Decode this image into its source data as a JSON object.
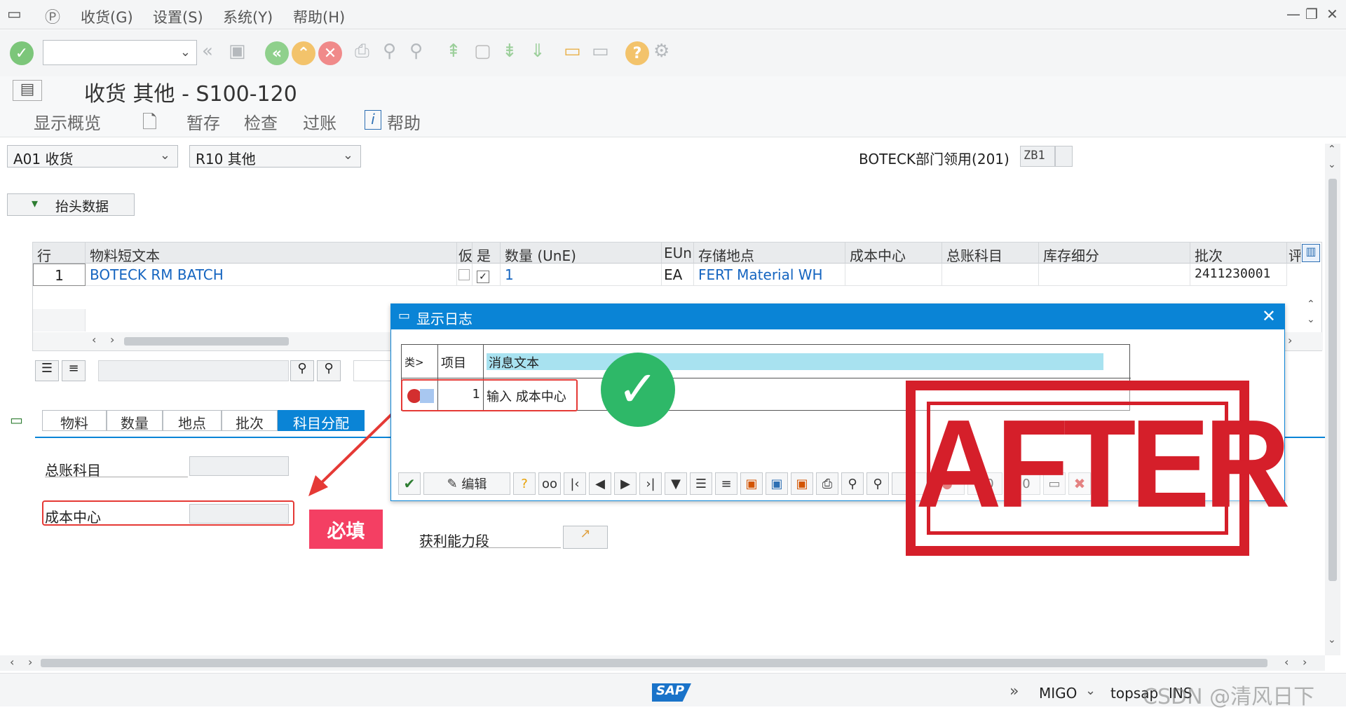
{
  "menu": {
    "items": [
      "收货(G)",
      "设置(S)",
      "系统(Y)",
      "帮助(H)"
    ]
  },
  "title": "收货 其他 - S100-120",
  "app_toolbar": {
    "overview": "显示概览",
    "hold": "暂存",
    "check": "检查",
    "post": "过账",
    "help": "帮助"
  },
  "selection": {
    "action": "A01 收货",
    "ref_doc": "R10 其他",
    "movement_text": "BOTECK部门领用(201)",
    "movement_code": "ZB1"
  },
  "header_data_button": "抬头数据",
  "table": {
    "headers": [
      "行",
      "物料短文本",
      "仮",
      "是",
      "数量 (UnE)",
      "EUn",
      "存储地点",
      "成本中心",
      "总账科目",
      "库存细分",
      "批次",
      "评"
    ],
    "row": {
      "line": "1",
      "material_text": "BOTECK RM BATCH",
      "qty": "1",
      "unit": "EA",
      "storage_loc": "FERT Material WH",
      "batch": "2411230001"
    }
  },
  "tabs": [
    "物料",
    "数量",
    "地点",
    "批次",
    "科目分配"
  ],
  "fields": {
    "gl_account": "总账科目",
    "cost_center": "成本中心",
    "profit_segment": "获利能力段"
  },
  "annotation": {
    "required": "必填"
  },
  "dialog": {
    "title": "显示日志",
    "col_type": "类>",
    "col_item": "项目",
    "col_msg": "消息文本",
    "row_item": "1",
    "row_msg": "输入  成本中心",
    "edit_label": "编辑",
    "count_error": "0",
    "count_warning": "0",
    "count_success": "0"
  },
  "stamp_text": "AFTER",
  "status": {
    "transaction": "MIGO",
    "system": "topsap",
    "mode": "INS",
    "watermark": "CSDN @清风日下"
  }
}
